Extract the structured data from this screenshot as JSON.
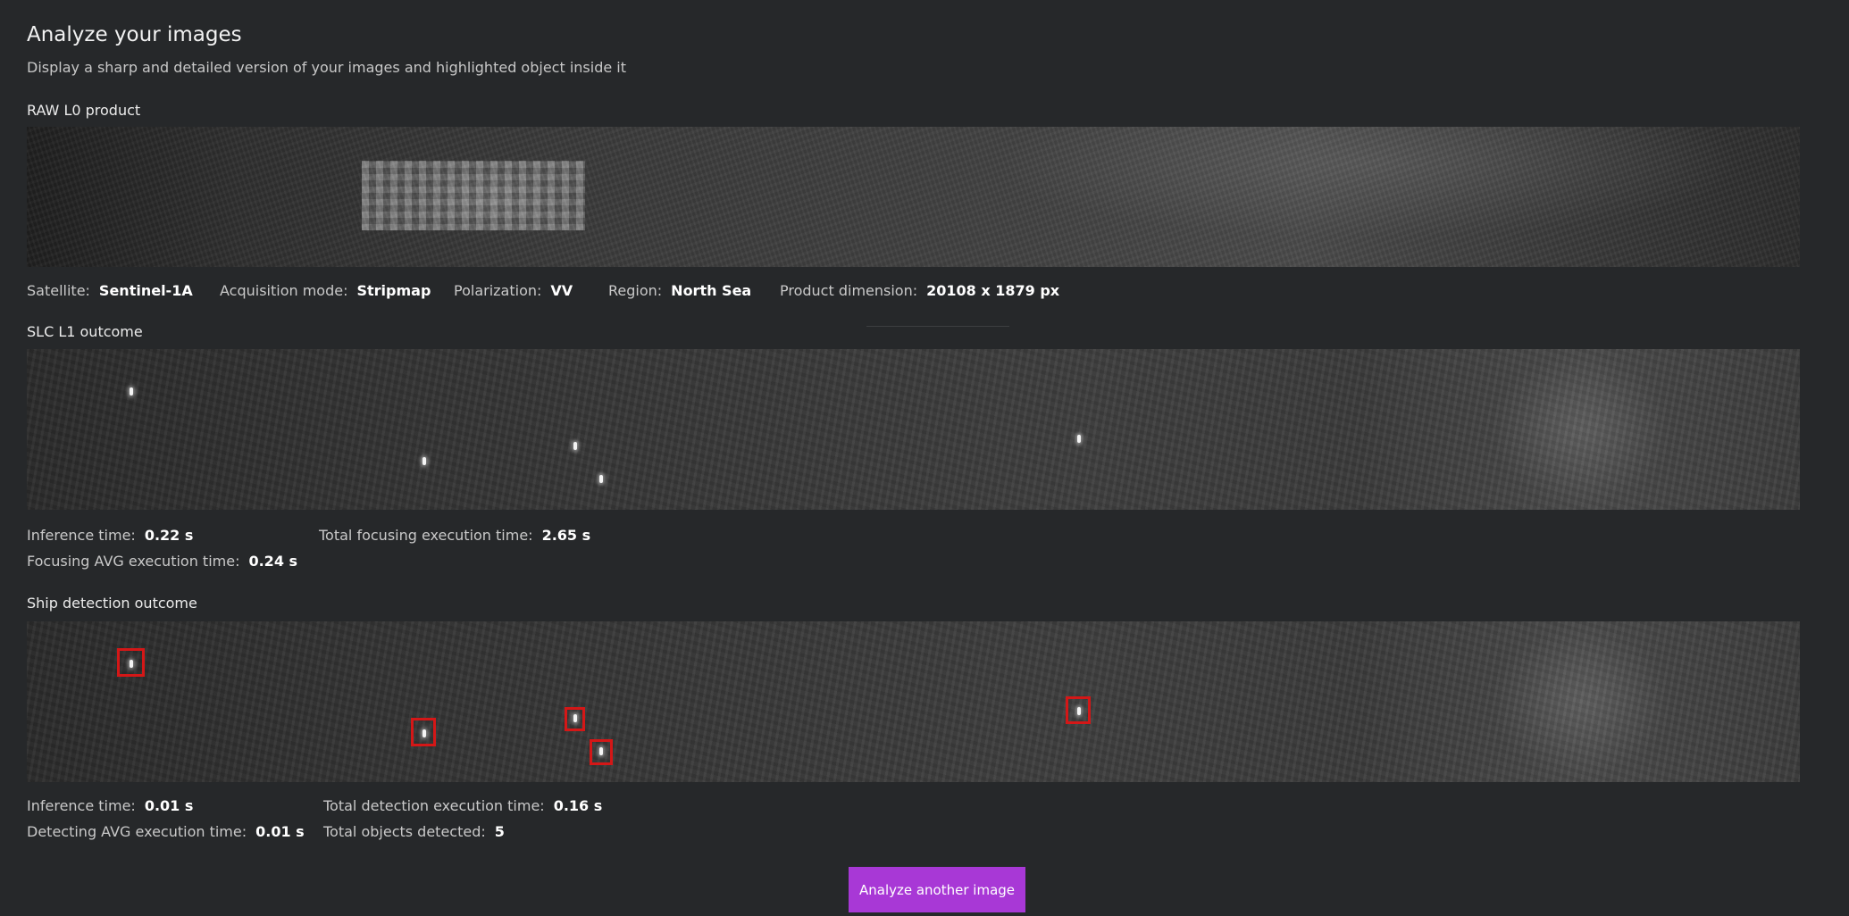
{
  "header": {
    "title": "Analyze your images",
    "subtitle": "Display a sharp and detailed version of your images and highlighted object inside it"
  },
  "raw_section": {
    "label": "RAW L0 product",
    "meta": [
      {
        "label": "Satellite:",
        "value": "Sentinel-1A"
      },
      {
        "label": "Acquisition mode:",
        "value": "Stripmap"
      },
      {
        "label": "Polarization:",
        "value": "VV"
      },
      {
        "label": "Region:",
        "value": "North Sea"
      },
      {
        "label": "Product dimension:",
        "value": "20108 x 1879 px"
      }
    ]
  },
  "slc_section": {
    "label": "SLC L1 outcome",
    "meta": [
      {
        "label": "Inference time:",
        "value": "0.22 s"
      },
      {
        "label": "Total focusing execution time:",
        "value": "2.65 s"
      },
      {
        "label": "Focusing AVG execution time:",
        "value": "0.24 s"
      }
    ]
  },
  "detection_section": {
    "label": "Ship detection outcome",
    "meta": [
      {
        "label": "Inference time:",
        "value": "0.01 s"
      },
      {
        "label": "Total detection execution time:",
        "value": "0.16 s"
      },
      {
        "label": "Detecting AVG execution time:",
        "value": "0.01 s"
      },
      {
        "label": "Total objects detected:",
        "value": "5"
      }
    ]
  },
  "actions": {
    "analyze_another_label": "Analyze another image"
  },
  "colors": {
    "background": "#26282a",
    "accent_button": "#a838d6",
    "detection_box": "#d41717"
  }
}
